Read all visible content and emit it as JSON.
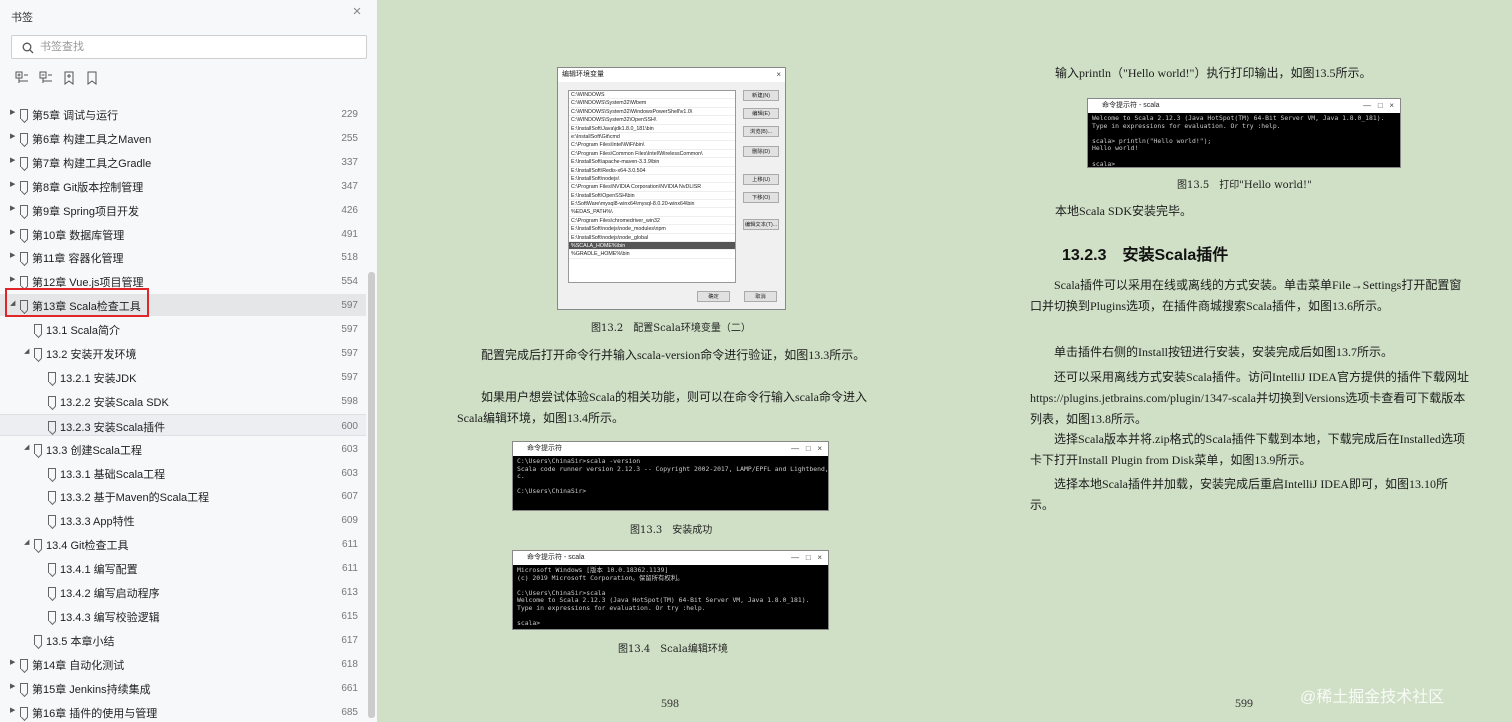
{
  "sidebar": {
    "title": "书签",
    "close_icon": "×",
    "search_placeholder": "书签查找",
    "toc": [
      {
        "label": "第5章 调试与运行",
        "page": "229",
        "level": 0,
        "expand": "collapsed"
      },
      {
        "label": "第6章 构建工具之Maven",
        "page": "255",
        "level": 0,
        "expand": "collapsed"
      },
      {
        "label": "第7章 构建工具之Gradle",
        "page": "337",
        "level": 0,
        "expand": "collapsed"
      },
      {
        "label": "第8章 Git版本控制管理",
        "page": "347",
        "level": 0,
        "expand": "collapsed"
      },
      {
        "label": "第9章 Spring项目开发",
        "page": "426",
        "level": 0,
        "expand": "collapsed"
      },
      {
        "label": "第10章 数据库管理",
        "page": "491",
        "level": 0,
        "expand": "collapsed"
      },
      {
        "label": "第11章 容器化管理",
        "page": "518",
        "level": 0,
        "expand": "collapsed"
      },
      {
        "label": "第12章 Vue.js项目管理",
        "page": "554",
        "level": 0,
        "expand": "collapsed"
      },
      {
        "label": "第13章 Scala检查工具",
        "page": "597",
        "level": 0,
        "expand": "expanded"
      },
      {
        "label": "13.1 Scala简介",
        "page": "597",
        "level": 1,
        "expand": "none"
      },
      {
        "label": "13.2 安装开发环境",
        "page": "597",
        "level": 1,
        "expand": "expanded"
      },
      {
        "label": "13.2.1 安装JDK",
        "page": "597",
        "level": 2,
        "expand": "none"
      },
      {
        "label": "13.2.2 安装Scala SDK",
        "page": "598",
        "level": 2,
        "expand": "none"
      },
      {
        "label": "13.2.3 安装Scala插件",
        "page": "600",
        "level": 2,
        "expand": "none"
      },
      {
        "label": "13.3 创建Scala工程",
        "page": "603",
        "level": 1,
        "expand": "expanded"
      },
      {
        "label": "13.3.1 基础Scala工程",
        "page": "603",
        "level": 2,
        "expand": "none"
      },
      {
        "label": "13.3.2 基于Maven的Scala工程",
        "page": "607",
        "level": 2,
        "expand": "none"
      },
      {
        "label": "13.3.3 App特性",
        "page": "609",
        "level": 2,
        "expand": "none"
      },
      {
        "label": "13.4 Git检查工具",
        "page": "611",
        "level": 1,
        "expand": "expanded"
      },
      {
        "label": "13.4.1 编写配置",
        "page": "611",
        "level": 2,
        "expand": "none"
      },
      {
        "label": "13.4.2 编写启动程序",
        "page": "613",
        "level": 2,
        "expand": "none"
      },
      {
        "label": "13.4.3 编写校验逻辑",
        "page": "615",
        "level": 2,
        "expand": "none"
      },
      {
        "label": "13.5 本章小结",
        "page": "617",
        "level": 1,
        "expand": "none"
      },
      {
        "label": "第14章 自动化测试",
        "page": "618",
        "level": 0,
        "expand": "collapsed"
      },
      {
        "label": "第15章 Jenkins持续集成",
        "page": "661",
        "level": 0,
        "expand": "collapsed"
      },
      {
        "label": "第16章 插件的使用与管理",
        "page": "685",
        "level": 0,
        "expand": "collapsed"
      }
    ]
  },
  "left_page": {
    "env_dialog": {
      "title": "编辑环境变量",
      "entries": [
        "C:\\WINDOWS",
        "C:\\WINDOWS\\System32\\Wbem",
        "C:\\WINDOWS\\System32\\WindowsPowerShell\\v1.0\\",
        "C:\\WINDOWS\\System32\\OpenSSH\\",
        "E:\\InstallSoft\\Java\\jdk1.8.0_181\\bin",
        "e:\\InstallSoft\\Git\\cmd",
        "C:\\Program Files\\Intel\\WiFi\\bin\\",
        "C:\\Program Files\\Common Files\\Intel\\WirelessCommon\\",
        "E:\\InstallSoft\\apache-maven-3.3.9\\bin",
        "E:\\InstallSoft\\Redis-x64-3.0.504",
        "E:\\InstallSoft\\nodejs\\",
        "C:\\Program Files\\NVIDIA Corporation\\NVIDIA NvDLISR",
        "E:\\InstallSoft\\OpenSSH\\bin",
        "E:\\SoftWare\\mysql8-winx64\\mysql-8.0.20-winx64\\bin",
        "%EDAS_PATH%\\",
        "C:\\Program Files\\chromedriver_win32",
        "E:\\InstallSoft\\nodejs\\node_modules\\npm",
        "E:\\InstallSoft\\nodejs\\node_global",
        "%SCALA_HOME%\\bin",
        "%GRADLE_HOME%\\bin"
      ],
      "selected_index": 18,
      "buttons": [
        "新建(N)",
        "编辑(E)",
        "浏览(B)...",
        "删除(D)",
        "上移(U)",
        "下移(O)",
        "编辑文本(T)..."
      ],
      "ok": "确定",
      "cancel": "取消"
    },
    "fig_13_2_caption": "图13.2　配置Scala环境变量（二）",
    "para1": "配置完成后打开命令行并输入scala-version命令进行验证，如图13.3所示。",
    "para2": "如果用户想尝试体验Scala的相关功能，则可以在命令行输入scala命令进入Scala编辑环境，如图13.4所示。",
    "cmd3": {
      "title": "命令提示符",
      "lines": "C:\\Users\\ChinaSir>scala -version\nScala code runner version 2.12.3 -- Copyright 2002-2017, LAMP/EPFL and Lightbend, In\nc.\n\nC:\\Users\\ChinaSir>"
    },
    "fig_13_3_caption": "图13.3　安装成功",
    "cmd4": {
      "title": "命令提示符 - scala",
      "lines": "Microsoft Windows [版本 10.0.18362.1139]\n(c) 2019 Microsoft Corporation。保留所有权利。\n\nC:\\Users\\ChinaSir>scala\nWelcome to Scala 2.12.3 (Java HotSpot(TM) 64-Bit Server VM, Java 1.8.0_181).\nType in expressions for evaluation. Or try :help.\n\nscala>"
    },
    "fig_13_4_caption": "图13.4　Scala编辑环境",
    "page_number": "598"
  },
  "right_page": {
    "para_print": "输入println（\"Hello world!\"）执行打印输出，如图13.5所示。",
    "cmd5": {
      "title": "命令提示符 - scala",
      "lines": "Welcome to Scala 2.12.3 (Java HotSpot(TM) 64-Bit Server VM, Java 1.8.0_181).\nType in expressions for evaluation. Or try :help.\n\nscala> println(\"Hello world!\");\nHello world!\n\nscala>"
    },
    "fig_13_5_caption": "图13.5　打印\"Hello world!\"",
    "para_done": "本地Scala SDK安装完毕。",
    "section_heading": "13.2.3　安装Scala插件",
    "para_a": "Scala插件可以采用在线或离线的方式安装。单击菜单File→Settings打开配置窗口并切换到Plugins选项，在插件商城搜索Scala插件，如图13.6所示。",
    "para_b": "单击插件右侧的Install按钮进行安装，安装完成后如图13.7所示。",
    "para_c": "还可以采用离线方式安装Scala插件。访问IntelliJ IDEA官方提供的插件下载网址https://plugins.jetbrains.com/plugin/1347-scala并切换到Versions选项卡查看可下载版本列表，如图13.8所示。",
    "para_d": "选择Scala版本并将.zip格式的Scala插件下载到本地，下载完成后在Installed选项卡下打开Install Plugin from Disk菜单，如图13.9所示。",
    "para_e": "选择本地Scala插件并加载，安装完成后重启IntelliJ IDEA即可，如图13.10所示。",
    "page_number": "599"
  },
  "watermark": "@稀土掘金技术社区"
}
